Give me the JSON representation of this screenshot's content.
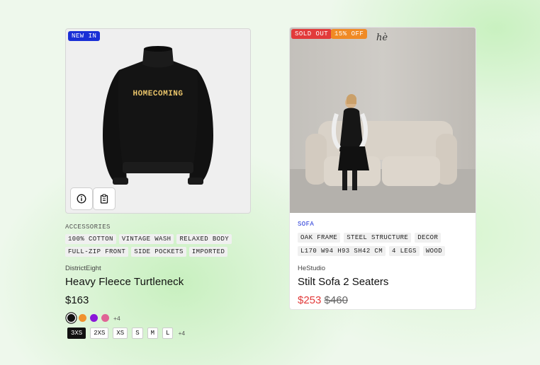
{
  "product1": {
    "badge": "NEW IN",
    "image_text": "HOMECOMING",
    "category": "ACCESSORIES",
    "tags": [
      "100% COTTON",
      "VINTAGE WASH",
      "RELAXED BODY",
      "FULL-ZIP FRONT",
      "SIDE POCKETS",
      "IMPORTED"
    ],
    "brand": "DistrictEight",
    "title": "Heavy Fleece Turtleneck",
    "price": "$163",
    "colors": [
      "#111111",
      "#f0922e",
      "#8a17d9",
      "#e06496"
    ],
    "colors_more": "+4",
    "sizes": [
      "3XS",
      "2XS",
      "XS",
      "S",
      "M",
      "L"
    ],
    "selected_size": "3XS",
    "sizes_more": "+4",
    "icons": [
      "info-icon",
      "clipboard-icon"
    ]
  },
  "product2": {
    "badge_sold": "SOLD OUT",
    "badge_discount": "15% OFF",
    "image_signature": "hè",
    "category": "SOFA",
    "tags": [
      "OAK FRAME",
      "STEEL STRUCTURE",
      "DECOR",
      "L170 W94 H93 SH42 CM",
      "4 LEGS",
      "WOOD"
    ],
    "brand": "HeStudio",
    "title": "Stilt Sofa 2 Seaters",
    "price": "$253",
    "original_price": "$460"
  }
}
